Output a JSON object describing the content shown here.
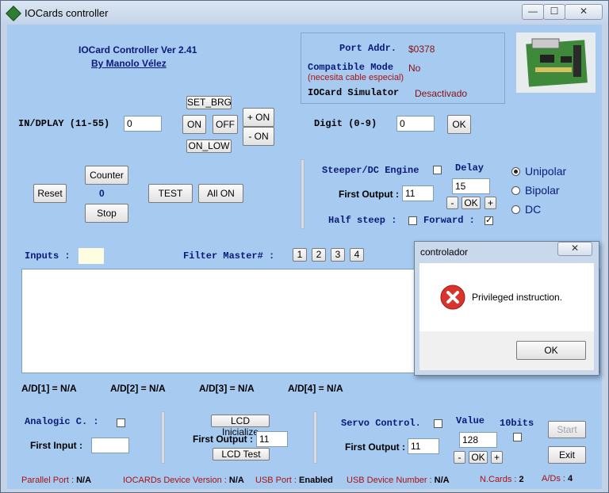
{
  "window": {
    "title": "IOCards controller",
    "min": "—",
    "max": "☐",
    "close": "✕"
  },
  "header": {
    "version": "IOCard Controller  Ver 2.41",
    "author": "By Manolo Vélez"
  },
  "info": {
    "port_label": "Port Addr.",
    "port_value": "$0378",
    "compat_label": "Compatible Mode",
    "compat_value": "No",
    "compat_note": "(necesita cable especial)",
    "sim_label": "IOCard Simulator",
    "sim_value": "Desactivado"
  },
  "display": {
    "label": "IN/DPLAY (11-55)",
    "value": "0",
    "set_brg": "SET_BRG",
    "on": "ON",
    "off": "OFF",
    "on_low": "ON_LOW",
    "plus_on": "+ ON",
    "minus_on": "- ON"
  },
  "digit": {
    "label": "Digit  (0-9)",
    "value": "0",
    "ok": "OK"
  },
  "counter": {
    "reset": "Reset",
    "counter": "Counter",
    "value": "0",
    "stop": "Stop",
    "test": "TEST",
    "all_on": "All ON"
  },
  "stepper": {
    "engine_label": "Steeper/DC Engine",
    "delay_label": "Delay",
    "delay_value": "15",
    "first_output_label": "First Output :",
    "first_output_value": "11",
    "minus": "-",
    "ok": "OK",
    "plus": "+",
    "half_label": "Half steep :",
    "forward_label": "Forward :",
    "forward_mark": "✓",
    "modes": [
      {
        "label": "Unipolar",
        "selected": true
      },
      {
        "label": "Bipolar",
        "selected": false
      },
      {
        "label": "DC",
        "selected": false
      }
    ]
  },
  "inputs": {
    "label": "Inputs :",
    "filter_label": "Filter Master# :",
    "filters": [
      "1",
      "2",
      "3",
      "4"
    ]
  },
  "ad": [
    {
      "label": "A/D[1] =",
      "value": "N/A"
    },
    {
      "label": "A/D[2] =",
      "value": "N/A"
    },
    {
      "label": "A/D[3] =",
      "value": "N/A"
    },
    {
      "label": "A/D[4] =",
      "value": "N/A"
    }
  ],
  "analog": {
    "label": "Analogic C. :",
    "first_input_label": "First Input  :",
    "first_input_value": ""
  },
  "lcd": {
    "init": "LCD Inicialize",
    "first_output_label": "First Output :",
    "first_output_value": "11",
    "test": "LCD Test"
  },
  "servo": {
    "label": "Servo Control.",
    "value_label": "Value",
    "bits_label": "10bits",
    "value": "128",
    "first_output_label": "First Output :",
    "first_output_value": "11",
    "minus": "-",
    "ok": "OK",
    "plus": "+",
    "start": "Start",
    "exit": "Exit"
  },
  "status": {
    "parallel_label": "Parallel Port :",
    "parallel_value": "N/A",
    "version_label": "IOCARDs Device  Version :",
    "version_value": "N/A",
    "usb_label": "USB Port :",
    "usb_value": "Enabled",
    "usbnum_label": "USB Device Number :",
    "usbnum_value": "N/A",
    "ncards_label": "N.Cards :",
    "ncards_value": "2",
    "ads_label": "A/Ds :",
    "ads_value": "4"
  },
  "dialog": {
    "title": "controlador",
    "close": "✕",
    "message": "Privileged instruction.",
    "ok": "OK"
  },
  "colors": {
    "client_bg": "#a6caf0",
    "label_red": "#b01010",
    "label_navy": "#0a1a7a",
    "error_red": "#d9332b"
  }
}
